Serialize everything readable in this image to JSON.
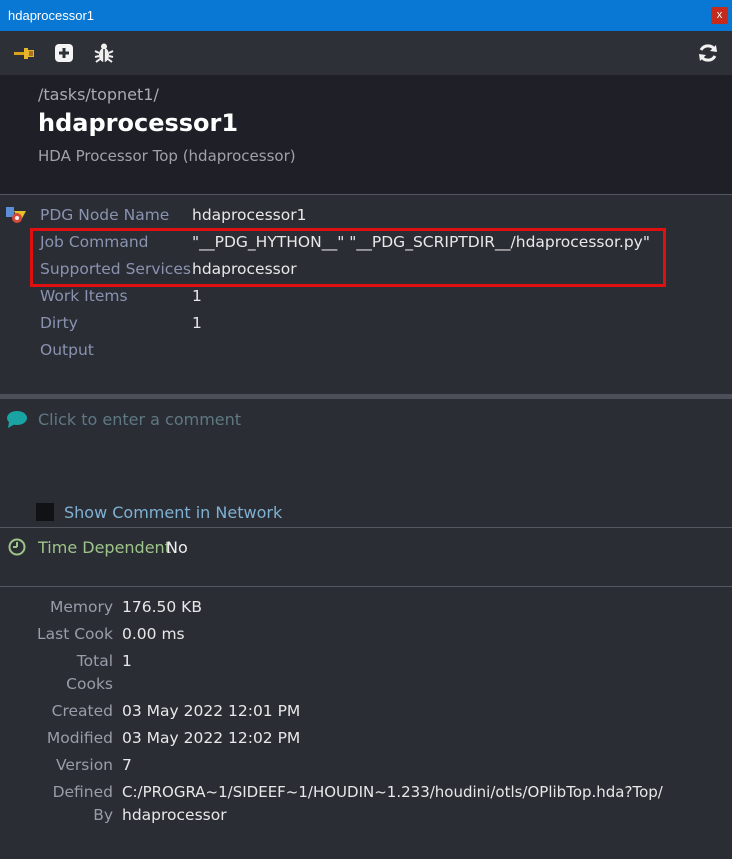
{
  "window": {
    "title": "hdaprocessor1",
    "close_label": "x"
  },
  "toolbar": {
    "icons": [
      "pin-icon",
      "add-icon",
      "bug-icon",
      "refresh-icon"
    ]
  },
  "header": {
    "path": "/tasks/topnet1/",
    "name": "hdaprocessor1",
    "type": "HDA Processor Top (hdaprocessor)"
  },
  "properties": [
    {
      "label": "PDG Node Name",
      "value": "hdaprocessor1"
    },
    {
      "label": "Job Command",
      "value": "\"__PDG_HYTHON__\" \"__PDG_SCRIPTDIR__/hdaprocessor.py\""
    },
    {
      "label": "Supported Services",
      "value": "hdaprocessor"
    },
    {
      "label": "Work Items",
      "value": "1"
    },
    {
      "label": "Dirty",
      "value": "1"
    },
    {
      "label": "Output",
      "value": ""
    }
  ],
  "comment": {
    "placeholder": "Click to enter a comment",
    "show_in_network_label": "Show Comment in Network"
  },
  "time_dependent": {
    "label": "Time Dependent",
    "value": "No"
  },
  "info": {
    "memory_label": "Memory",
    "memory": "176.50 KB",
    "last_cook_label": "Last Cook",
    "last_cook": "0.00 ms",
    "total_cooks_label_1": "Total",
    "total_cooks_label_2": "Cooks",
    "total_cooks": "1",
    "created_label": "Created",
    "created": "03 May 2022 12:01 PM",
    "modified_label": "Modified",
    "modified": "03 May 2022 12:02 PM",
    "version_label": "Version",
    "version": "7",
    "defined_by_label_1": "Defined",
    "defined_by_label_2": "By",
    "defined_by_1": "C:/PROGRA~1/SIDEEF~1/HOUDIN~1.233/houdini/otls/OPlibTop.hda?Top/",
    "defined_by_2": "hdaprocessor"
  },
  "colors": {
    "titlebar": "#0878d4",
    "highlight_border": "#e01010",
    "property_label": "#8a93b0",
    "time_dependent_label": "#9fc48a",
    "link_text": "#7fb1d3"
  }
}
